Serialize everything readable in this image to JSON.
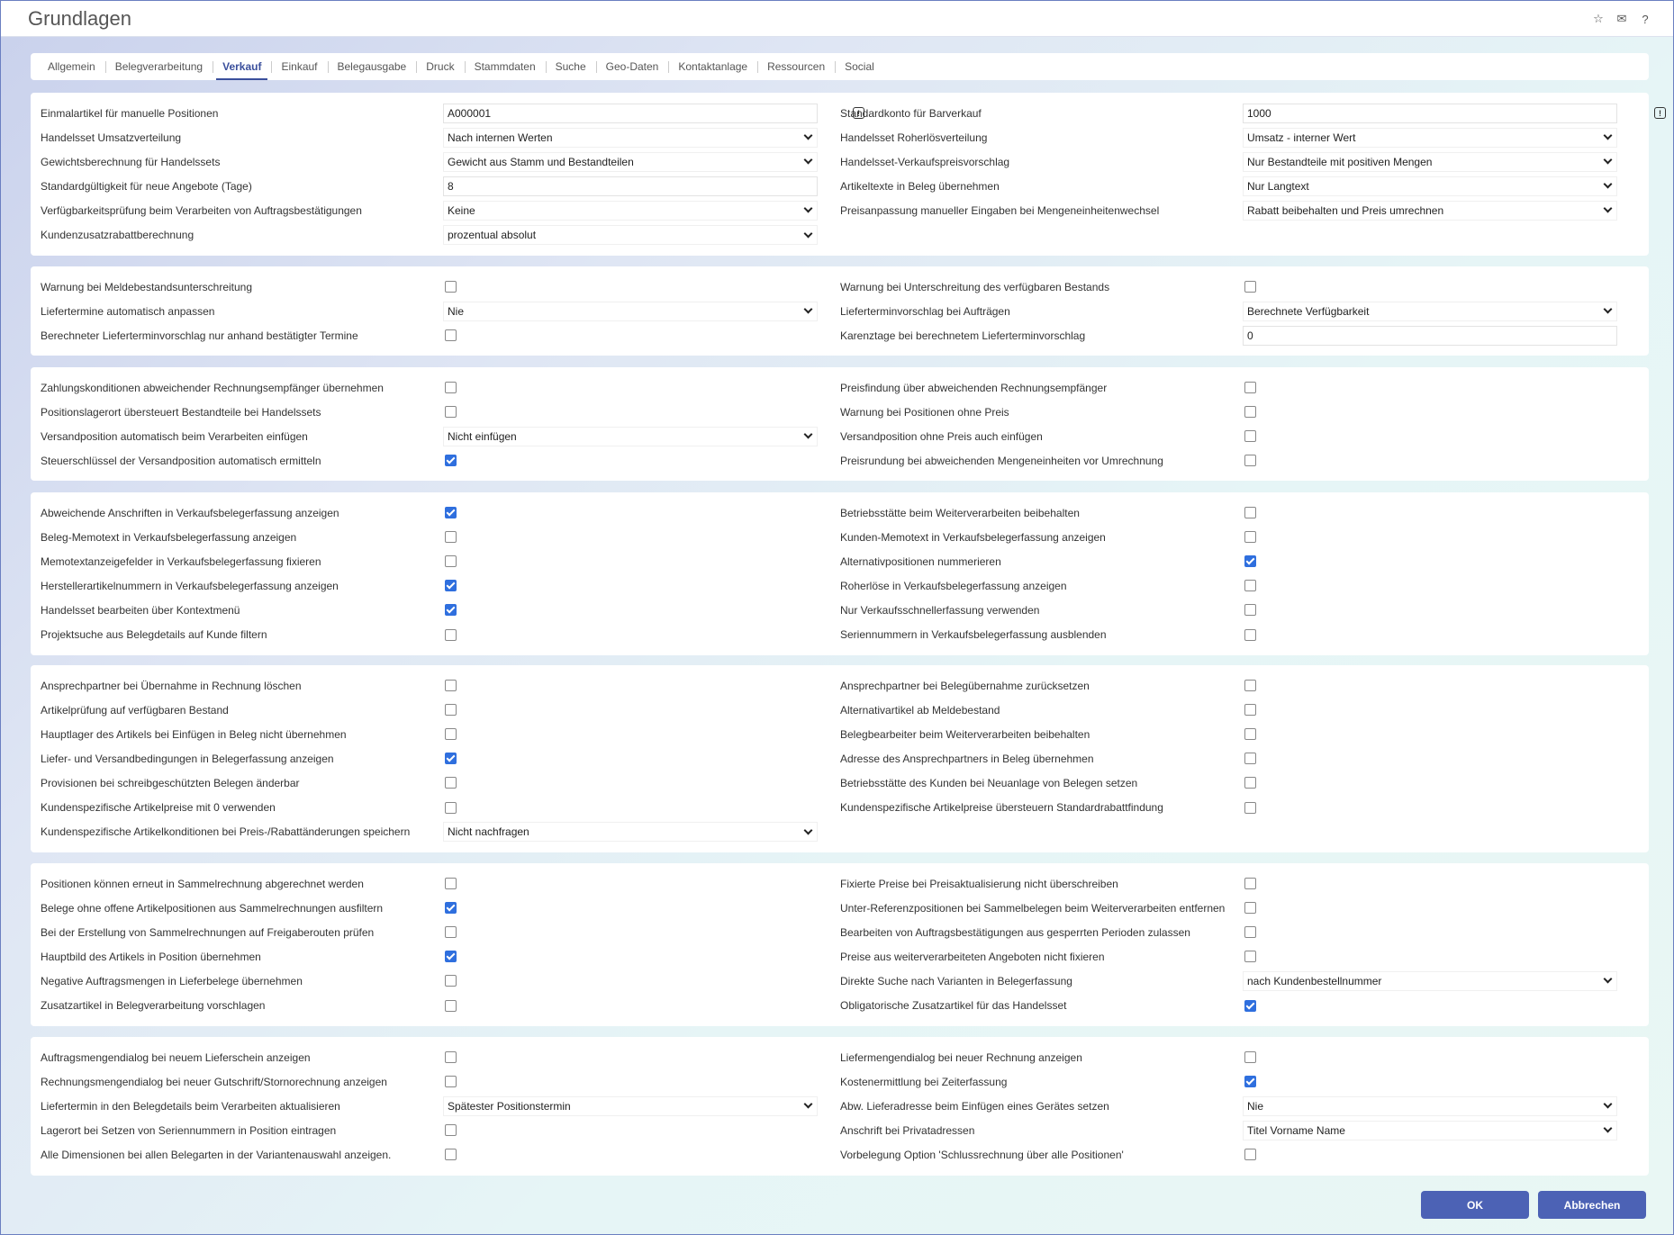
{
  "window": {
    "title": "Grundlagen",
    "icons": [
      "star-icon",
      "mail-icon",
      "help-icon"
    ]
  },
  "tabs": [
    {
      "label": "Allgemein"
    },
    {
      "label": "Belegverarbeitung"
    },
    {
      "label": "Verkauf",
      "active": true
    },
    {
      "label": "Einkauf"
    },
    {
      "label": "Belegausgabe"
    },
    {
      "label": "Druck"
    },
    {
      "label": "Stammdaten"
    },
    {
      "label": "Suche"
    },
    {
      "label": "Geo-Daten"
    },
    {
      "label": "Kontaktanlage"
    },
    {
      "label": "Ressourcen"
    },
    {
      "label": "Social"
    }
  ],
  "sections": [
    {
      "left": [
        {
          "label": "Einmalartikel für manuelle Positionen",
          "type": "input",
          "value": "A000001",
          "info": true
        },
        {
          "label": "Handelsset Umsatzverteilung",
          "type": "select",
          "value": "Nach internen Werten"
        },
        {
          "label": "Gewichtsberechnung für Handelssets",
          "type": "select",
          "value": "Gewicht aus Stamm und Bestandteilen"
        },
        {
          "label": "Standardgültigkeit für neue Angebote (Tage)",
          "type": "input",
          "value": "8"
        },
        {
          "label": "Verfügbarkeitsprüfung beim Verarbeiten von Auftragsbestätigungen",
          "type": "select",
          "value": "Keine"
        },
        {
          "label": "Kundenzusatzrabattberechnung",
          "type": "select",
          "value": "prozentual absolut"
        }
      ],
      "right": [
        {
          "label": "Standardkonto für Barverkauf",
          "type": "input",
          "value": "1000",
          "info": true
        },
        {
          "label": "Handelsset Roherlösverteilung",
          "type": "select",
          "value": "Umsatz - interner Wert"
        },
        {
          "label": "Handelsset-Verkaufspreisvorschlag",
          "type": "select",
          "value": "Nur Bestandteile mit positiven Mengen"
        },
        {
          "label": "Artikeltexte in Beleg übernehmen",
          "type": "select",
          "value": "Nur Langtext"
        },
        {
          "label": "Preisanpassung manueller Eingaben bei Mengeneinheitenwechsel",
          "type": "select",
          "value": "Rabatt beibehalten und Preis umrechnen"
        }
      ]
    },
    {
      "left": [
        {
          "label": "Warnung bei Meldebestandsunterschreitung",
          "type": "checkbox",
          "checked": false
        },
        {
          "label": "Liefertermine automatisch anpassen",
          "type": "select",
          "value": "Nie"
        },
        {
          "label": "Berechneter Lieferterminvorschlag nur anhand bestätigter Termine",
          "type": "checkbox",
          "checked": false
        }
      ],
      "right": [
        {
          "label": "Warnung bei Unterschreitung des verfügbaren Bestands",
          "type": "checkbox",
          "checked": false
        },
        {
          "label": "Lieferterminvorschlag bei Aufträgen",
          "type": "select",
          "value": "Berechnete Verfügbarkeit"
        },
        {
          "label": "Karenztage bei berechnetem Lieferterminvorschlag",
          "type": "input",
          "value": "0"
        }
      ]
    },
    {
      "left": [
        {
          "label": "Zahlungskonditionen abweichender Rechnungsempfänger übernehmen",
          "type": "checkbox",
          "checked": false
        },
        {
          "label": "Positionslagerort übersteuert Bestandteile bei Handelssets",
          "type": "checkbox",
          "checked": false
        },
        {
          "label": "Versandposition automatisch beim Verarbeiten einfügen",
          "type": "select",
          "value": "Nicht einfügen"
        },
        {
          "label": "Steuerschlüssel der Versandposition automatisch ermitteln",
          "type": "checkbox",
          "checked": true
        }
      ],
      "right": [
        {
          "label": "Preisfindung über abweichenden Rechnungsempfänger",
          "type": "checkbox",
          "checked": false
        },
        {
          "label": "Warnung bei Positionen ohne Preis",
          "type": "checkbox",
          "checked": false
        },
        {
          "label": "Versandposition ohne Preis auch einfügen",
          "type": "checkbox",
          "checked": false
        },
        {
          "label": "Preisrundung bei abweichenden Mengeneinheiten vor Umrechnung",
          "type": "checkbox",
          "checked": false
        }
      ]
    },
    {
      "left": [
        {
          "label": "Abweichende Anschriften in Verkaufsbelegerfassung anzeigen",
          "type": "checkbox",
          "checked": true
        },
        {
          "label": "Beleg-Memotext in Verkaufsbelegerfassung anzeigen",
          "type": "checkbox",
          "checked": false
        },
        {
          "label": "Memotextanzeigefelder in Verkaufsbelegerfassung fixieren",
          "type": "checkbox",
          "checked": false
        },
        {
          "label": "Herstellerartikelnummern in Verkaufsbelegerfassung anzeigen",
          "type": "checkbox",
          "checked": true
        },
        {
          "label": "Handelsset bearbeiten über Kontextmenü",
          "type": "checkbox",
          "checked": true
        },
        {
          "label": "Projektsuche aus Belegdetails auf Kunde filtern",
          "type": "checkbox",
          "checked": false
        }
      ],
      "right": [
        {
          "label": "Betriebsstätte beim Weiterverarbeiten beibehalten",
          "type": "checkbox",
          "checked": false
        },
        {
          "label": "Kunden-Memotext in Verkaufsbelegerfassung anzeigen",
          "type": "checkbox",
          "checked": false
        },
        {
          "label": "Alternativpositionen nummerieren",
          "type": "checkbox",
          "checked": true
        },
        {
          "label": "Roherlöse in Verkaufsbelegerfassung anzeigen",
          "type": "checkbox",
          "checked": false
        },
        {
          "label": "Nur Verkaufsschnellerfassung verwenden",
          "type": "checkbox",
          "checked": false
        },
        {
          "label": "Seriennummern in Verkaufsbelegerfassung ausblenden",
          "type": "checkbox",
          "checked": false
        }
      ]
    },
    {
      "left": [
        {
          "label": "Ansprechpartner bei Übernahme in Rechnung löschen",
          "type": "checkbox",
          "checked": false
        },
        {
          "label": "Artikelprüfung auf verfügbaren Bestand",
          "type": "checkbox",
          "checked": false
        },
        {
          "label": "Hauptlager des Artikels bei Einfügen in Beleg nicht übernehmen",
          "type": "checkbox",
          "checked": false
        },
        {
          "label": "Liefer- und Versandbedingungen in Belegerfassung anzeigen",
          "type": "checkbox",
          "checked": true
        },
        {
          "label": "Provisionen bei schreibgeschützten Belegen änderbar",
          "type": "checkbox",
          "checked": false
        },
        {
          "label": "Kundenspezifische Artikelpreise mit 0 verwenden",
          "type": "checkbox",
          "checked": false
        },
        {
          "label": "Kundenspezifische Artikelkonditionen bei Preis-/Rabattänderungen speichern",
          "type": "select",
          "value": "Nicht nachfragen"
        }
      ],
      "right": [
        {
          "label": "Ansprechpartner bei Belegübernahme zurücksetzen",
          "type": "checkbox",
          "checked": false
        },
        {
          "label": "Alternativartikel ab Meldebestand",
          "type": "checkbox",
          "checked": false
        },
        {
          "label": "Belegbearbeiter beim Weiterverarbeiten beibehalten",
          "type": "checkbox",
          "checked": false
        },
        {
          "label": "Adresse des Ansprechpartners in Beleg übernehmen",
          "type": "checkbox",
          "checked": false
        },
        {
          "label": "Betriebsstätte des Kunden bei Neuanlage von Belegen setzen",
          "type": "checkbox",
          "checked": false
        },
        {
          "label": "Kundenspezifische Artikelpreise übersteuern Standardrabattfindung",
          "type": "checkbox",
          "checked": false
        }
      ]
    },
    {
      "left": [
        {
          "label": "Positionen können erneut in Sammelrechnung abgerechnet werden",
          "type": "checkbox",
          "checked": false
        },
        {
          "label": "Belege ohne offene Artikelpositionen aus Sammelrechnungen ausfiltern",
          "type": "checkbox",
          "checked": true
        },
        {
          "label": "Bei der Erstellung von Sammelrechnungen auf Freigaberouten prüfen",
          "type": "checkbox",
          "checked": false
        },
        {
          "label": "Hauptbild des Artikels in Position übernehmen",
          "type": "checkbox",
          "checked": true
        },
        {
          "label": "Negative Auftragsmengen in Lieferbelege übernehmen",
          "type": "checkbox",
          "checked": false
        },
        {
          "label": "Zusatzartikel in Belegverarbeitung vorschlagen",
          "type": "checkbox",
          "checked": false
        }
      ],
      "right": [
        {
          "label": "Fixierte Preise bei Preisaktualisierung nicht überschreiben",
          "type": "checkbox",
          "checked": false
        },
        {
          "label": "Unter-Referenzpositionen bei Sammelbelegen beim Weiterverarbeiten entfernen",
          "type": "checkbox",
          "checked": false
        },
        {
          "label": "Bearbeiten von Auftragsbestätigungen aus gesperrten Perioden zulassen",
          "type": "checkbox",
          "checked": false
        },
        {
          "label": "Preise aus weiterverarbeiteten Angeboten nicht fixieren",
          "type": "checkbox",
          "checked": false
        },
        {
          "label": "Direkte Suche nach Varianten in Belegerfassung",
          "type": "select",
          "value": "nach Kundenbestellnummer"
        },
        {
          "label": "Obligatorische Zusatzartikel für das Handelsset",
          "type": "checkbox",
          "checked": true
        }
      ]
    },
    {
      "left": [
        {
          "label": "Auftragsmengendialog bei neuem Lieferschein anzeigen",
          "type": "checkbox",
          "checked": false
        },
        {
          "label": "Rechnungsmengendialog bei neuer Gutschrift/Stornorechnung anzeigen",
          "type": "checkbox",
          "checked": false
        },
        {
          "label": "Liefertermin in den Belegdetails beim Verarbeiten aktualisieren",
          "type": "select",
          "value": "Spätester Positionstermin"
        },
        {
          "label": "Lagerort bei Setzen von Seriennummern in Position eintragen",
          "type": "checkbox",
          "checked": false
        },
        {
          "label": "Alle Dimensionen bei allen Belegarten in der Variantenauswahl anzeigen.",
          "type": "checkbox",
          "checked": false
        }
      ],
      "right": [
        {
          "label": "Liefermengendialog bei neuer Rechnung anzeigen",
          "type": "checkbox",
          "checked": false
        },
        {
          "label": "Kostenermittlung bei Zeiterfassung",
          "type": "checkbox",
          "checked": true
        },
        {
          "label": "Abw. Lieferadresse beim Einfügen eines Gerätes setzen",
          "type": "select",
          "value": "Nie"
        },
        {
          "label": "Anschrift bei Privatadressen",
          "type": "select",
          "value": "Titel Vorname Name"
        },
        {
          "label": "Vorbelegung Option 'Schlussrechnung über alle Positionen'",
          "type": "checkbox",
          "checked": false
        }
      ]
    }
  ],
  "footer": {
    "ok_label": "OK",
    "cancel_label": "Abbrechen"
  }
}
